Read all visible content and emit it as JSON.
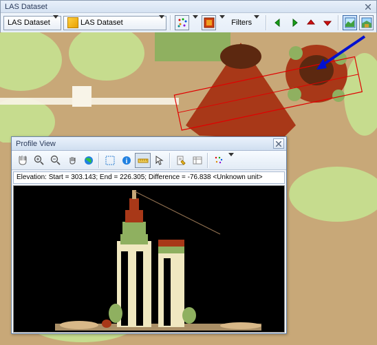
{
  "toolbar": {
    "title": "LAS Dataset",
    "menu_label": "LAS Dataset",
    "layer_label": "LAS Dataset",
    "filters_label": "Filters"
  },
  "profile": {
    "title": "Profile View",
    "status_prefix": "Elevation: Start = ",
    "start": "303.143",
    "status_mid1": ";  End = ",
    "end": "226.305",
    "status_mid2": ";  Difference = ",
    "difference": "-76.838",
    "status_suffix": " <Unknown unit>"
  },
  "colors": {
    "map_ground": "#c8a878",
    "map_veg_light": "#c6dc8e",
    "map_veg_med": "#8fb060",
    "building": "#a83818",
    "dark_brown": "#5c2810",
    "cream": "#f0e8c0",
    "arrow": "#0010d0"
  }
}
